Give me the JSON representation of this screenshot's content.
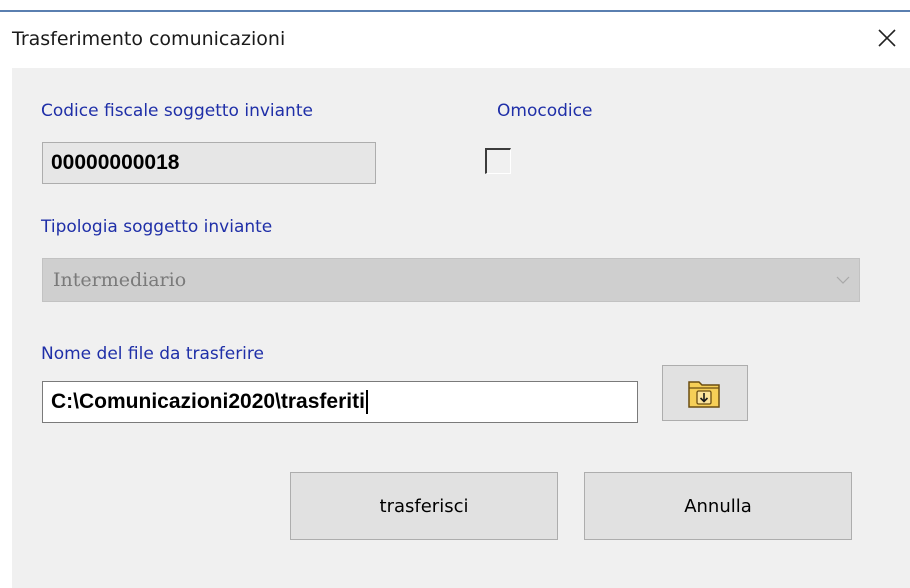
{
  "window": {
    "title": "Trasferimento comunicazioni",
    "close_icon": "close-icon"
  },
  "form": {
    "codice_fiscale": {
      "label": "Codice fiscale soggetto inviante",
      "value": "00000000018"
    },
    "omocodice": {
      "label": "Omocodice",
      "checked": false
    },
    "tipologia": {
      "label": "Tipologia soggetto inviante",
      "selected": "Intermediario",
      "disabled": true
    },
    "nome_file": {
      "label": "Nome del file da trasferire",
      "value": "C:\\Comunicazioni2020\\trasferiti",
      "browse_icon": "folder-open-icon"
    }
  },
  "buttons": {
    "transfer_label": "trasferisci",
    "cancel_label": "Annulla"
  },
  "colors": {
    "label_blue": "#1f2fa8",
    "dialog_bg": "#f0f0f0",
    "button_bg": "#e1e1e1",
    "folder_yellow": "#f6cf57"
  }
}
